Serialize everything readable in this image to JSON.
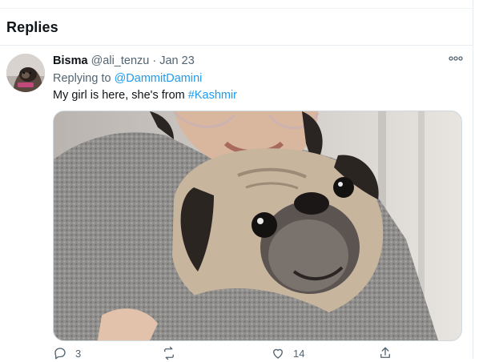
{
  "section": {
    "title": "Replies"
  },
  "tweet": {
    "display_name": "Bisma",
    "handle": "@ali_tenzu",
    "separator": "·",
    "date": "Jan 23",
    "replying_prefix": "Replying to",
    "replying_to": "@DammitDamini",
    "text_main": "My girl is here, she's from",
    "hashtag": "#Kashmir",
    "more_icon": "more-icon",
    "media_description": "photo-of-pug",
    "actions": {
      "reply_count": "3",
      "retweet_count": "",
      "like_count": "14",
      "share_count": ""
    }
  },
  "colors": {
    "link": "#1d9bf0",
    "muted": "#536471",
    "border": "#e6ecf0"
  }
}
